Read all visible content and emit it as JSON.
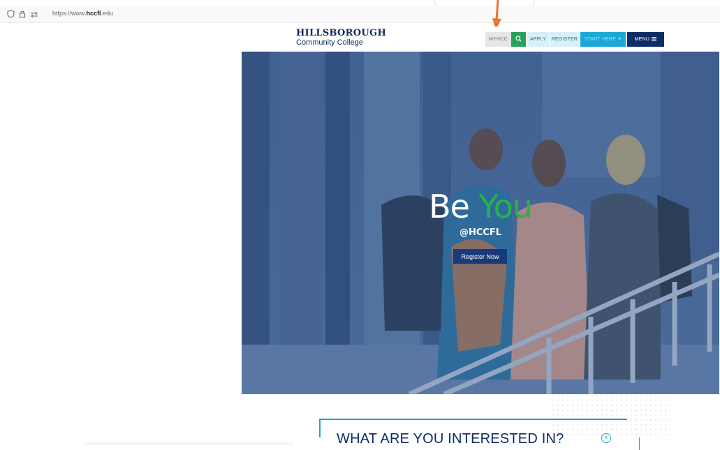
{
  "browser": {
    "url_prefix": "https://www.",
    "url_host": "hccfl",
    "url_suffix": ".edu"
  },
  "header": {
    "logo_line1": "HILLSBOROUGH",
    "logo_line2": "Community College",
    "nav": {
      "myhcc": "MYHCC",
      "apply": "APPLY",
      "register": "REGISTER",
      "start_here": "START HERE",
      "menu": "MENU"
    }
  },
  "hero": {
    "title_word1": "Be",
    "title_word2": "You",
    "handle": "@HCCFL",
    "cta": "Register Now"
  },
  "section": {
    "interest_title": "WHAT ARE YOU INTERESTED IN?",
    "plus_symbol": "+"
  },
  "colors": {
    "brand_navy": "#0e2c66",
    "accent_green": "#27b24a",
    "accent_cyan": "#1aa8d6",
    "annotation_arrow": "#e8772e"
  },
  "icons": [
    "shield-icon",
    "lock-icon",
    "permissions-icon",
    "search-icon",
    "chevron-down-icon",
    "hamburger-icon",
    "plus-circle-icon"
  ]
}
